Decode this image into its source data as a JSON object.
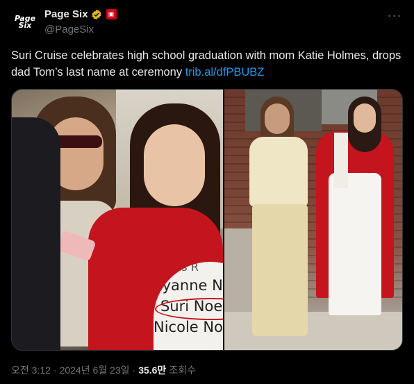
{
  "author": {
    "avatar_text_line1": "Page",
    "avatar_text_line2": "Six",
    "display_name": "Page Six",
    "handle": "@PageSix",
    "verified_icon": "verified-badge-icon",
    "affiliate_icon": "affiliate-badge-icon"
  },
  "menu": {
    "more_label": "···"
  },
  "tweet": {
    "text": "Suri Cruise celebrates high school graduation with mom Katie Holmes, drops dad Tom’s last name at ceremony ",
    "link_text": "trib.al/dfPBUBZ"
  },
  "media": {
    "inset_lines": [
      "ious R",
      "ryanne Nob",
      "Suri Noelle",
      "Nicole Norieg"
    ]
  },
  "meta": {
    "time": "오전 3:12",
    "date": "2024년 6월 23일",
    "separator": "·",
    "views_count": "35.6만",
    "views_label": "조회수"
  },
  "colors": {
    "background": "#000000",
    "text": "#e7e9ea",
    "muted": "#71767b",
    "link": "#1d9bf0",
    "verified_gold": "#e2b719",
    "affiliate_red": "#d0021b"
  }
}
